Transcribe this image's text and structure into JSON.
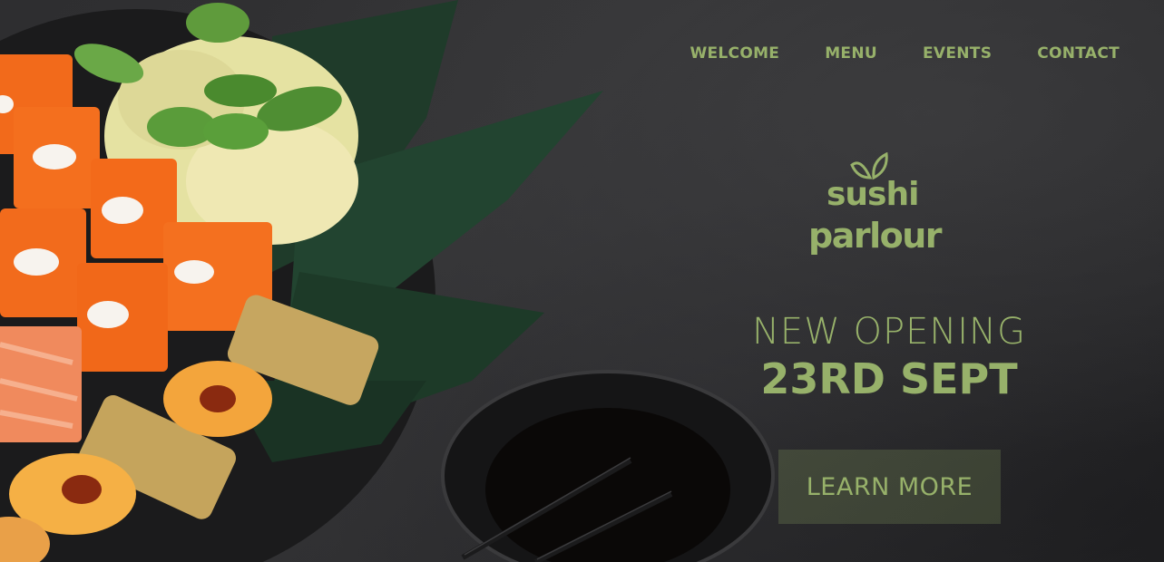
{
  "nav": {
    "items": [
      {
        "label": "WELCOME"
      },
      {
        "label": "MENU"
      },
      {
        "label": "EVENTS"
      },
      {
        "label": "CONTACT"
      }
    ]
  },
  "logo": {
    "line1": "sushi",
    "line2": "parlour"
  },
  "hero": {
    "line1": "NEW OPENING",
    "line2": "23RD SEPT",
    "cta_label": "LEARN MORE"
  },
  "colors": {
    "accent": "#97b16a",
    "background": "#2e2e30"
  }
}
